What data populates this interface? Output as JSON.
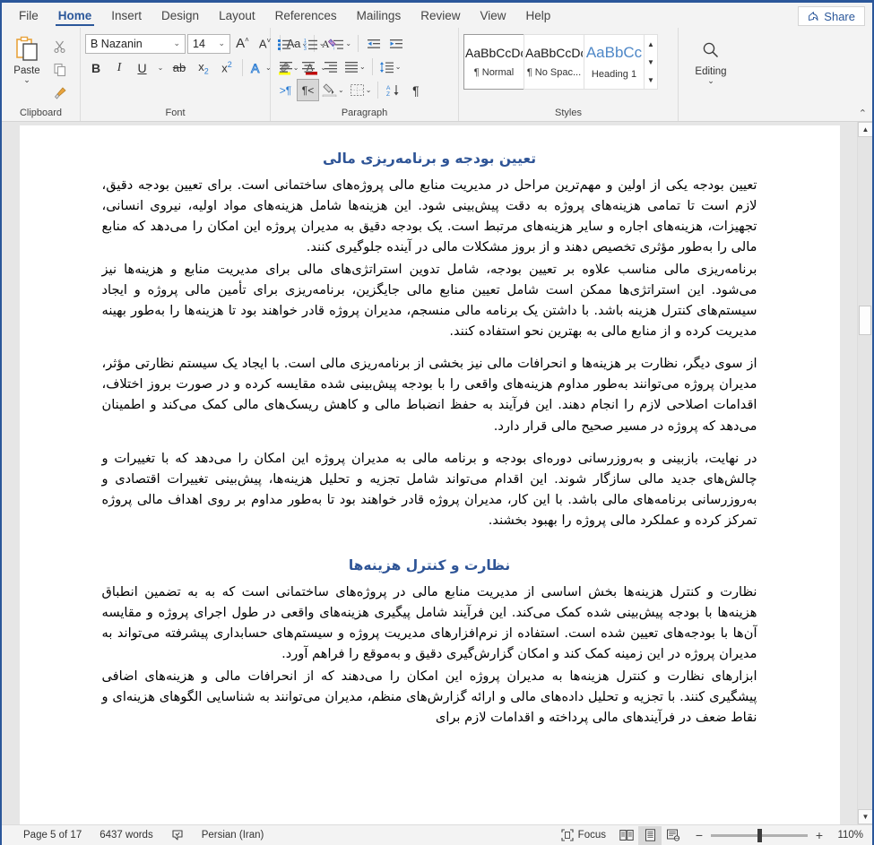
{
  "window": {
    "tabs": [
      {
        "label": "File",
        "active": false
      },
      {
        "label": "Home",
        "active": true
      },
      {
        "label": "Insert",
        "active": false
      },
      {
        "label": "Design",
        "active": false
      },
      {
        "label": "Layout",
        "active": false
      },
      {
        "label": "References",
        "active": false
      },
      {
        "label": "Mailings",
        "active": false
      },
      {
        "label": "Review",
        "active": false
      },
      {
        "label": "View",
        "active": false
      },
      {
        "label": "Help",
        "active": false
      }
    ],
    "share_label": "Share",
    "accent_color": "#2b579a"
  },
  "ribbon": {
    "clipboard": {
      "label": "Clipboard",
      "paste_label": "Paste",
      "cut_icon": "scissors-icon",
      "copy_icon": "copy-icon",
      "format_painter_icon": "paintbrush-icon"
    },
    "font": {
      "label": "Font",
      "font_name": "B Nazanin",
      "font_size": "14",
      "bold_label": "B",
      "italic_label": "I",
      "underline_label": "U",
      "strikethrough_label": "ab",
      "subscript_label": "x",
      "superscript_label": "x",
      "grow_font_label": "A",
      "shrink_font_label": "A",
      "change_case_label": "Aa",
      "clear_format_label": "A",
      "text_effects_label": "A",
      "highlight_label": "highlight-icon",
      "font_color_label": "A",
      "font_color_swatch": "#c00000",
      "highlight_swatch": "#ffff00",
      "text_effects_color": "#2b7cd3"
    },
    "paragraph": {
      "label": "Paragraph",
      "bullets_icon": "bullet-list-icon",
      "numbering_icon": "numbered-list-icon",
      "multilevel_icon": "multilevel-list-icon",
      "decrease_indent_icon": "decrease-indent-icon",
      "increase_indent_icon": "increase-indent-icon",
      "align_left_icon": "align-left-icon",
      "align_center_icon": "align-center-icon",
      "align_right_icon": "align-right-icon",
      "justify_icon": "justify-icon",
      "line_spacing_icon": "line-spacing-icon",
      "ltr_icon": "left-to-right-icon",
      "rtl_icon": "right-to-left-icon",
      "rtl_active": true,
      "shading_icon": "shading-icon",
      "borders_icon": "borders-icon",
      "sort_icon": "sort-icon",
      "show_marks_icon": "paragraph-mark-icon"
    },
    "styles": {
      "label": "Styles",
      "items": [
        {
          "sample": "AaBbCcDc",
          "name": "¶ Normal",
          "selected": true,
          "heading": false
        },
        {
          "sample": "AaBbCcDc",
          "name": "¶ No Spac...",
          "selected": false,
          "heading": false
        },
        {
          "sample": "AaBbCс",
          "name": "Heading 1",
          "selected": false,
          "heading": true
        }
      ],
      "heading_color": "#4e87c7"
    },
    "editing": {
      "label": "Editing",
      "icon": "search-icon"
    },
    "collapse_icon": "chevron-up-icon"
  },
  "document": {
    "blocks": [
      {
        "type": "heading",
        "text": "تعیین بودجه و برنامه‌ریزی مالی"
      },
      {
        "type": "paragraph",
        "text": "تعیین بودجه یکی از اولین و مهم‌ترین مراحل در مدیریت منابع مالی پروژه‌های ساختمانی است. برای تعیین بودجه دقیق، لازم است تا تمامی هزینه‌های پروژه به دقت پیش‌بینی شود. این هزینه‌ها شامل هزینه‌های مواد اولیه، نیروی انسانی، تجهیزات، هزینه‌های اجاره و سایر هزینه‌های مرتبط است. یک بودجه دقیق به مدیران پروژه این امکان را می‌دهد که منابع مالی را به‌طور مؤثری تخصیص دهند و از بروز مشکلات مالی در آینده جلوگیری کنند."
      },
      {
        "type": "paragraph",
        "text": "برنامه‌ریزی مالی مناسب علاوه بر تعیین بودجه، شامل تدوین استراتژی‌های مالی برای مدیریت منابع و هزینه‌ها نیز می‌شود. این استراتژی‌ها ممکن است شامل تعیین منابع مالی جایگزین، برنامه‌ریزی برای تأمین مالی پروژه و ایجاد سیستم‌های کنترل هزینه باشد. با داشتن یک برنامه مالی منسجم، مدیران پروژه قادر خواهند بود تا هزینه‌ها را به‌طور بهینه مدیریت کرده و از منابع مالی به بهترین نحو استفاده کنند."
      },
      {
        "type": "paragraph",
        "gap": true,
        "text": "از سوی دیگر، نظارت بر هزینه‌ها و انحرافات مالی نیز بخشی از برنامه‌ریزی مالی است. با ایجاد یک سیستم نظارتی مؤثر، مدیران پروژه می‌توانند به‌طور مداوم هزینه‌های واقعی را با بودجه پیش‌بینی شده مقایسه کرده و در صورت بروز اختلاف، اقدامات اصلاحی لازم را انجام دهند. این فرآیند به حفظ انضباط مالی و کاهش ریسک‌های مالی کمک می‌کند و اطمینان می‌دهد که پروژه در مسیر صحیح مالی قرار دارد."
      },
      {
        "type": "paragraph",
        "gap": true,
        "text": "در نهایت، بازبینی و به‌روزرسانی دوره‌ای بودجه و برنامه مالی به مدیران پروژه این امکان را می‌دهد که با تغییرات و چالش‌های جدید مالی سازگار شوند. این اقدام می‌تواند شامل تجزیه و تحلیل هزینه‌ها، پیش‌بینی تغییرات اقتصادی و به‌روزرسانی برنامه‌های مالی باشد. با این کار، مدیران پروژه قادر خواهند بود تا به‌طور مداوم بر روی اهداف مالی پروژه تمرکز کرده و عملکرد مالی پروژه را بهبود بخشند."
      },
      {
        "type": "heading2",
        "text": "نظارت و کنترل هزینه‌ها"
      },
      {
        "type": "paragraph",
        "text": "نظارت و کنترل هزینه‌ها بخش اساسی از مدیریت منابع مالی در پروژه‌های ساختمانی است که به به تضمین انطباق هزینه‌ها با بودجه پیش‌بینی شده کمک می‌کند. این فرآیند شامل پیگیری هزینه‌های واقعی در طول اجرای پروژه و مقایسه آن‌ها با بودجه‌های تعیین شده است. استفاده از نرم‌افزارهای مدیریت پروژه و سیستم‌های حسابداری پیشرفته می‌تواند به مدیران پروژه در این زمینه کمک کند و امکان گزارش‌گیری دقیق و به‌موقع را فراهم آورد."
      },
      {
        "type": "paragraph",
        "text": "ابزارهای نظارت و کنترل هزینه‌ها به مدیران پروژه این امکان را می‌دهند که از انحرافات مالی و هزینه‌های اضافی پیشگیری کنند. با تجزیه و تحلیل داده‌های مالی و ارائه گزارش‌های منظم، مدیران می‌توانند به شناسایی الگوهای هزینه‌ای و نقاط ضعف در فرآیندهای مالی پرداخته و اقدامات لازم برای"
      }
    ],
    "heading_color": "#2e5496"
  },
  "status_bar": {
    "page_info": "Page 5 of 17",
    "word_count": "6437 words",
    "proofing_icon": "proofing-errors-icon",
    "language": "Persian (Iran)",
    "focus_label": "Focus",
    "focus_icon": "focus-mode-icon",
    "read_mode_icon": "read-mode-icon",
    "print_layout_icon": "print-layout-icon",
    "web_layout_icon": "web-layout-icon",
    "active_view": "print-layout",
    "zoom_out_label": "−",
    "zoom_in_label": "+",
    "zoom_level": "110%"
  }
}
